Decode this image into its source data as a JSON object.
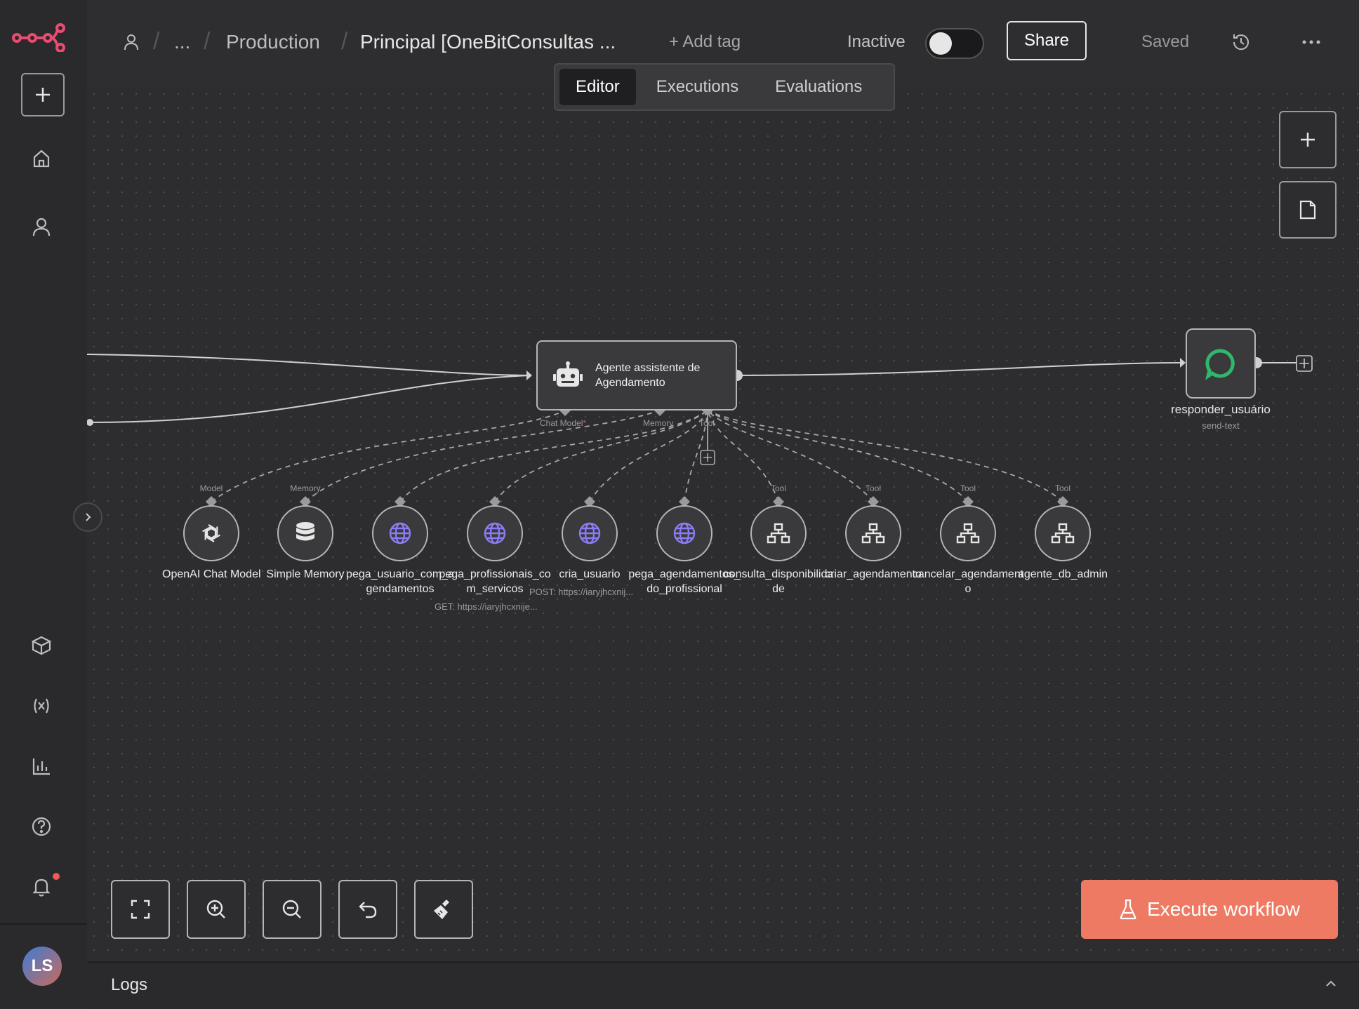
{
  "colors": {
    "brand": "#ea4b71",
    "agent_node_border": "#b5b5b5",
    "http_tool_icon": "#8b7cf6",
    "chat_icon": "#2fb86b",
    "execute_button": "#ef7a63",
    "notification_dot": "#ef5a5a"
  },
  "sidebar": {
    "logo_icon": "n8n-logo-icon",
    "items": [
      {
        "name": "add",
        "icon": "plus-icon"
      },
      {
        "name": "home",
        "icon": "home-icon"
      },
      {
        "name": "personal",
        "icon": "user-icon"
      },
      {
        "name": "templates",
        "icon": "box-icon"
      },
      {
        "name": "variables",
        "icon": "variables-icon"
      },
      {
        "name": "insights",
        "icon": "chart-bar-icon"
      },
      {
        "name": "help",
        "icon": "help-icon"
      },
      {
        "name": "notifications",
        "icon": "bell-icon",
        "has_dot": true
      }
    ],
    "user_initials": "LS"
  },
  "header": {
    "breadcrumb": {
      "ellipsis": "...",
      "project": "Production",
      "title": "Principal [OneBitConsultas ..."
    },
    "add_tag": "+ Add tag",
    "status_label": "Inactive",
    "share": "Share",
    "saved": "Saved"
  },
  "tabs": [
    {
      "label": "Editor",
      "active": true
    },
    {
      "label": "Executions",
      "active": false
    },
    {
      "label": "Evaluations",
      "active": false
    }
  ],
  "canvas": {
    "agent_node": {
      "label": "Agente assistente de Agendamento",
      "ports": {
        "chat_model": "Chat Model",
        "chat_model_required": "*",
        "memory": "Memory",
        "tool": "Tool"
      }
    },
    "output_node": {
      "label": "responder_usuário",
      "subtitle": "send-text"
    },
    "sub_nodes": [
      {
        "label": "OpenAI Chat Model",
        "slot": "Model",
        "icon": "openai-icon"
      },
      {
        "label": "Simple Memory",
        "slot": "Memory",
        "icon": "database-icon"
      },
      {
        "label": "pega_usuario_com_agendamentos",
        "slot": "",
        "icon": "globe-icon"
      },
      {
        "label": "pega_profissionais_com_servicos",
        "slot": "",
        "icon": "globe-icon",
        "sub": "GET: https://iaryjhcxnije..."
      },
      {
        "label": "cria_usuario",
        "slot": "",
        "icon": "globe-icon",
        "sub": "POST: https://iaryjhcxnij..."
      },
      {
        "label": "pega_agendamentos_do_profissional",
        "slot": "",
        "icon": "globe-icon"
      },
      {
        "label": "consulta_disponibilidade",
        "slot": "Tool",
        "icon": "workflow-icon"
      },
      {
        "label": "criar_agendamento",
        "slot": "Tool",
        "icon": "workflow-icon"
      },
      {
        "label": "cancelar_agendamento",
        "slot": "Tool",
        "icon": "workflow-icon"
      },
      {
        "label": "agente_db_admin",
        "slot": "Tool",
        "icon": "workflow-icon"
      }
    ]
  },
  "controls": {
    "zoom_to_fit": "fullscreen-icon",
    "zoom_in": "zoom-in-icon",
    "zoom_out": "zoom-out-icon",
    "reset": "undo-icon",
    "tidy_up": "broom-icon"
  },
  "execute_button": "Execute workflow",
  "logs": {
    "title": "Logs"
  }
}
